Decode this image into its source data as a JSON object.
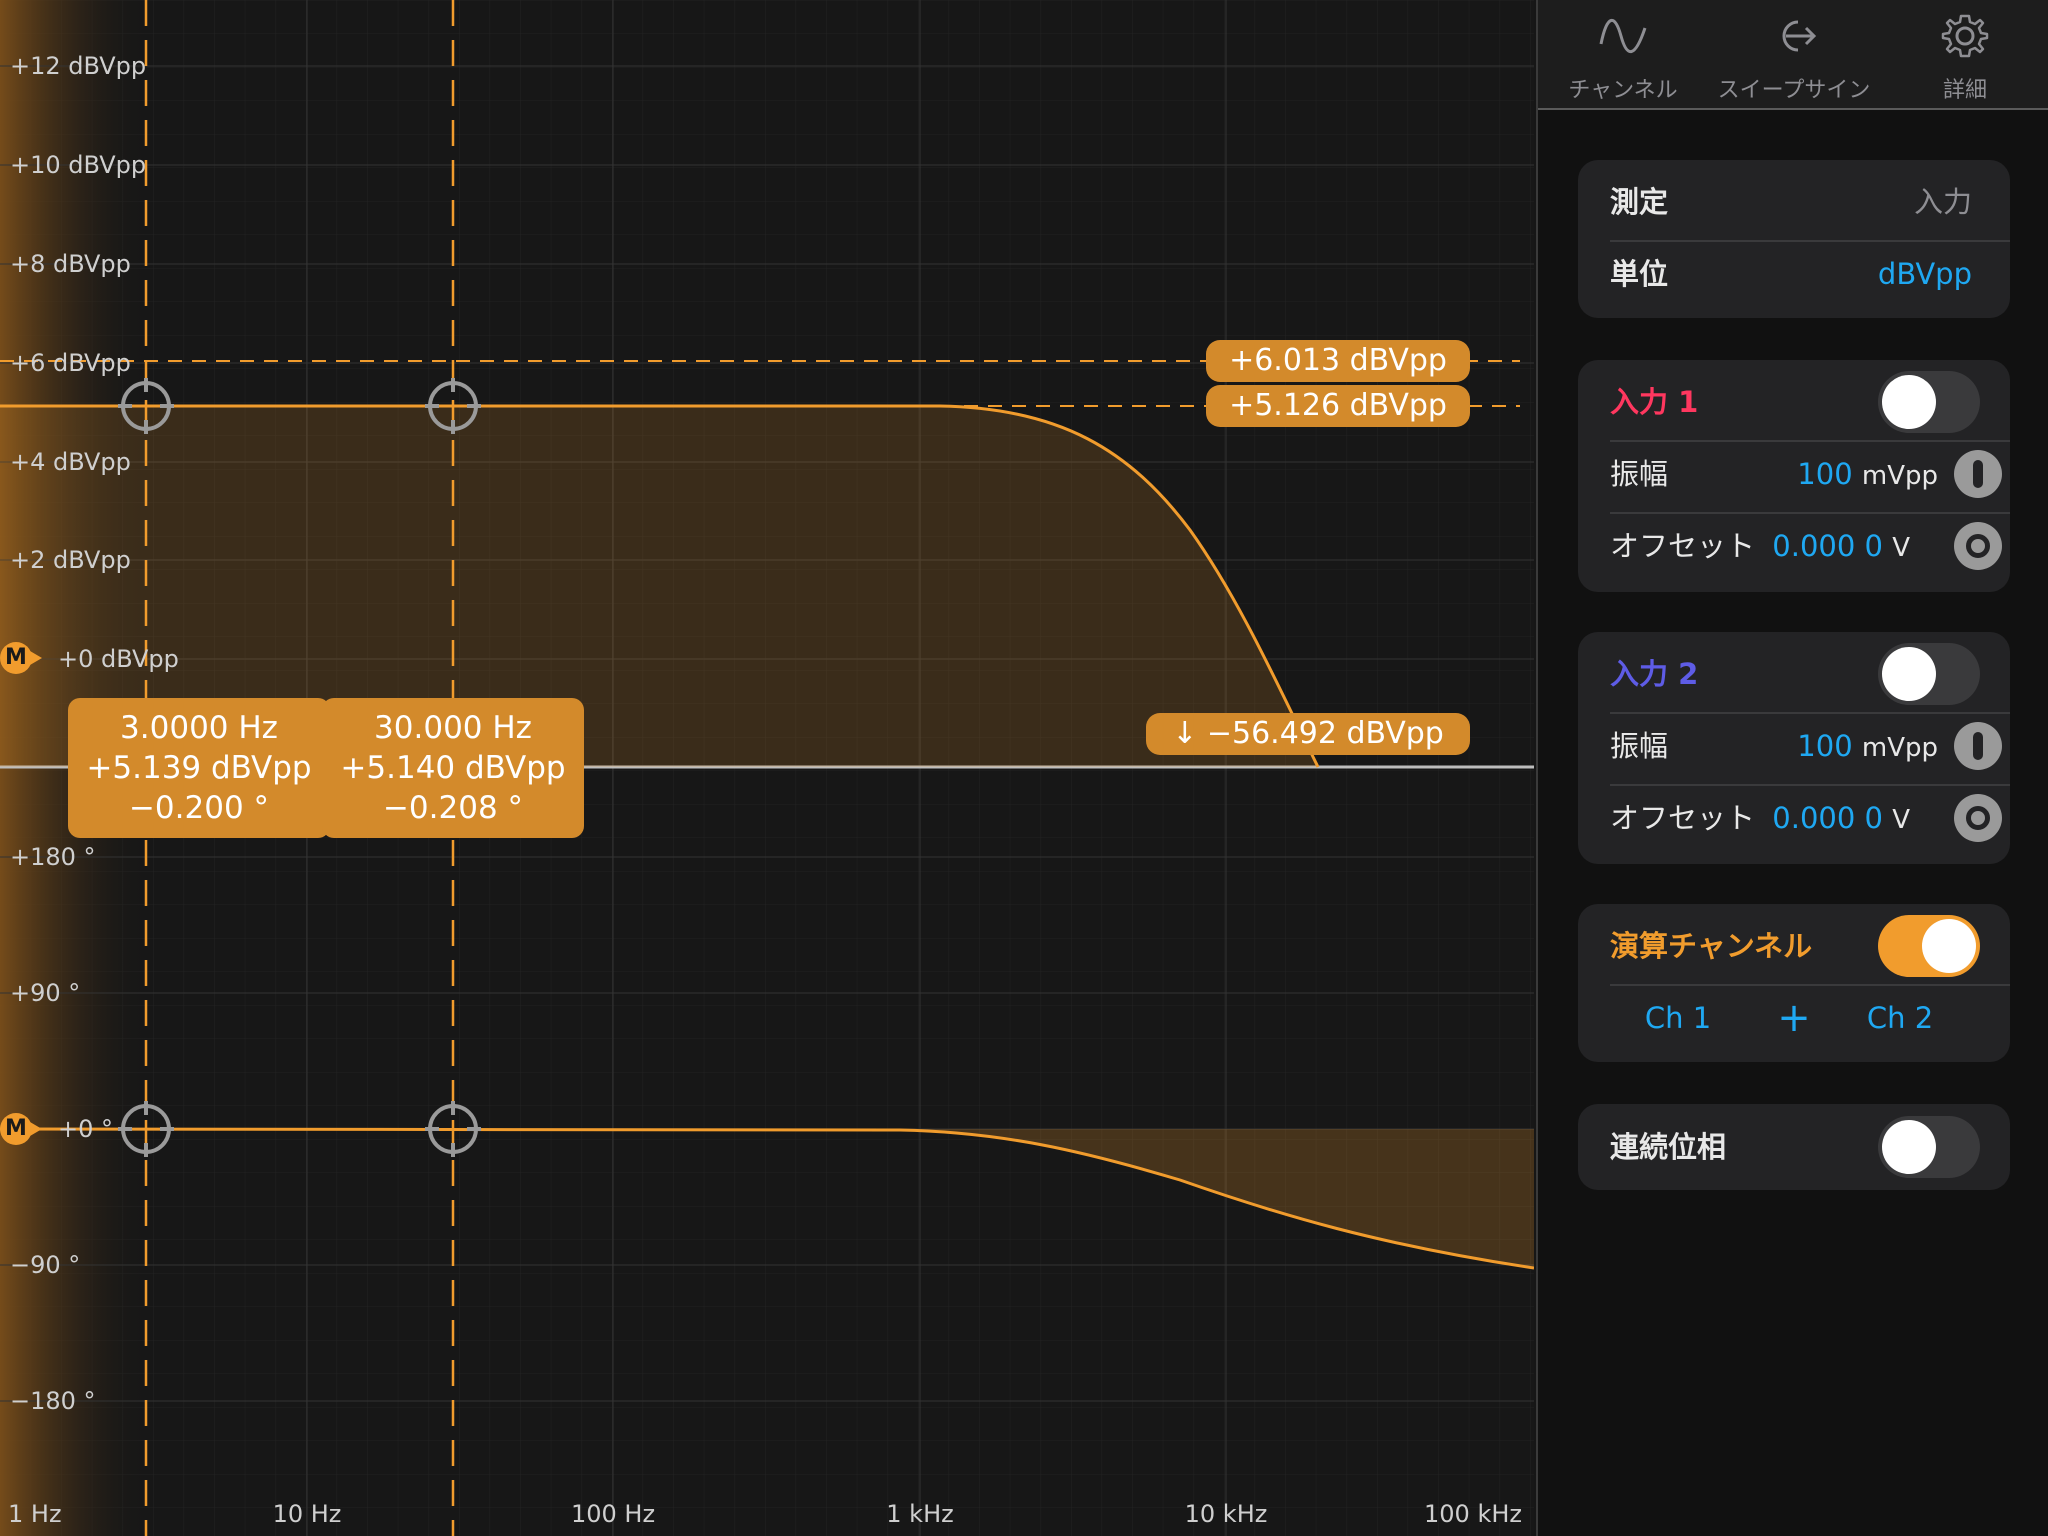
{
  "plot": {
    "mag_axis_labels": [
      "+12 dBVpp",
      "+10 dBVpp",
      "+8 dBVpp",
      "+6 dBVpp",
      "+4 dBVpp",
      "+2 dBVpp",
      "+0 dBVpp"
    ],
    "phase_axis_labels": [
      "+180 °",
      "+90 °",
      "+0 °",
      "−90 °",
      "−180 °"
    ],
    "freq_axis_labels": [
      "1 Hz",
      "10 Hz",
      "100 Hz",
      "1 kHz",
      "10 kHz",
      "100 kHz"
    ],
    "marker_badge": "M",
    "level_pills": {
      "upper": "+6.013 dBVpp",
      "lower": "+5.126 dBVpp",
      "bottom": "↓ −56.492 dBVpp"
    },
    "cursor1": {
      "freq": "3.0000 Hz",
      "mag": "+5.139 dBVpp",
      "phase": "−0.200 °"
    },
    "cursor2": {
      "freq": "30.000 Hz",
      "mag": "+5.140 dBVpp",
      "phase": "−0.208 °"
    },
    "colors": {
      "trace": "#f19c2d",
      "pill": "#d38a2b",
      "grid": "#2c2c2c"
    }
  },
  "tabs": [
    {
      "label": "チャンネル",
      "icon": "sine-wave-icon"
    },
    {
      "label": "スイープサイン",
      "icon": "sweep-export-icon"
    },
    {
      "label": "詳細",
      "icon": "gear-icon"
    }
  ],
  "measure_card": {
    "measure_label": "測定",
    "measure_value": "入力",
    "unit_label": "単位",
    "unit_value": "dBVpp"
  },
  "input1": {
    "title": "入力 1",
    "title_color": "#ff375f",
    "enabled": false,
    "amp_label": "振幅",
    "amp_value": "100",
    "amp_unit": "mVpp",
    "offset_label": "オフセット",
    "offset_value": "0.000 0",
    "offset_unit": "V"
  },
  "input2": {
    "title": "入力 2",
    "title_color": "#5e5ce6",
    "enabled": false,
    "amp_label": "振幅",
    "amp_value": "100",
    "amp_unit": "mVpp",
    "offset_label": "オフセット",
    "offset_value": "0.000 0",
    "offset_unit": "V"
  },
  "math_channel": {
    "title": "演算チャンネル",
    "enabled": true,
    "operand1": "Ch 1",
    "operator": "+",
    "operand2": "Ch 2"
  },
  "continuous_phase": {
    "title": "連続位相",
    "enabled": false
  }
}
